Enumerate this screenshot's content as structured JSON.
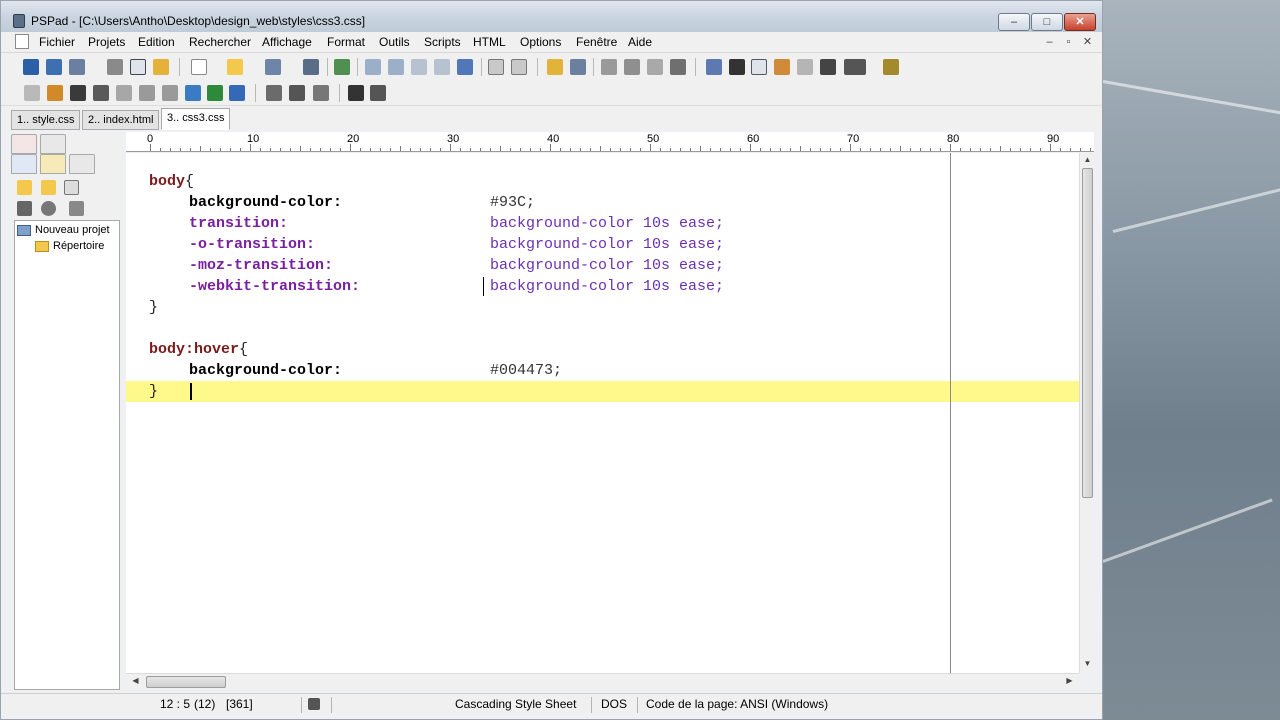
{
  "window": {
    "title": "PSPad - [C:\\Users\\Antho\\Desktop\\design_web\\styles\\css3.css]",
    "caption_buttons": {
      "minimize": "–",
      "maximize": "□",
      "close": "✕"
    }
  },
  "menu": {
    "items": [
      "Fichier",
      "Projets",
      "Edition",
      "Rechercher",
      "Affichage",
      "Format",
      "Outils",
      "Scripts",
      "HTML",
      "Options",
      "Fenêtre",
      "Aide"
    ],
    "mdi_buttons": [
      "–",
      "▫",
      "✕"
    ]
  },
  "tabs": [
    {
      "label": "1.. style.css"
    },
    {
      "label": "2.. index.html"
    },
    {
      "label": "3.. css3.css"
    }
  ],
  "project_tree": {
    "root": "Nouveau projet",
    "child": "Répertoire"
  },
  "ruler": {
    "labels": [
      "0",
      "10",
      "20",
      "30",
      "40",
      "50",
      "60",
      "70",
      "80",
      "90"
    ]
  },
  "code": {
    "lines": [
      {
        "sel": "body",
        "open": "{"
      },
      {
        "prop": "background-color:",
        "val": "#93C;",
        "kind": "prop"
      },
      {
        "prop": "transition:",
        "val": "background-color 10s ease;",
        "kind": "vprop"
      },
      {
        "prop": "-o-transition:",
        "val": "background-color 10s ease;",
        "kind": "vprop"
      },
      {
        "prop": "-moz-transition:",
        "val": "background-color 10s ease;",
        "kind": "vprop"
      },
      {
        "prop": "-webkit-transition:",
        "val": "background-color 10s ease;",
        "kind": "vprop"
      },
      {
        "close": "}"
      },
      {
        "blank": ""
      },
      {
        "sel": "body:hover",
        "open": "{"
      },
      {
        "prop": "background-color:",
        "val": "#004473;",
        "kind": "prop"
      },
      {
        "close": "}"
      }
    ]
  },
  "status": {
    "position": "12 : 5",
    "col": "(12)",
    "size": "[361]",
    "syntax": "Cascading Style Sheet",
    "line_end": "DOS",
    "codepage": "Code de la page: ANSI (Windows)"
  },
  "colors": {
    "selector": "#7b1b1b",
    "property": "#000000",
    "vendor_property": "#7a1fa2",
    "value": "#6b2fb3",
    "current_line": "#fff88a"
  }
}
